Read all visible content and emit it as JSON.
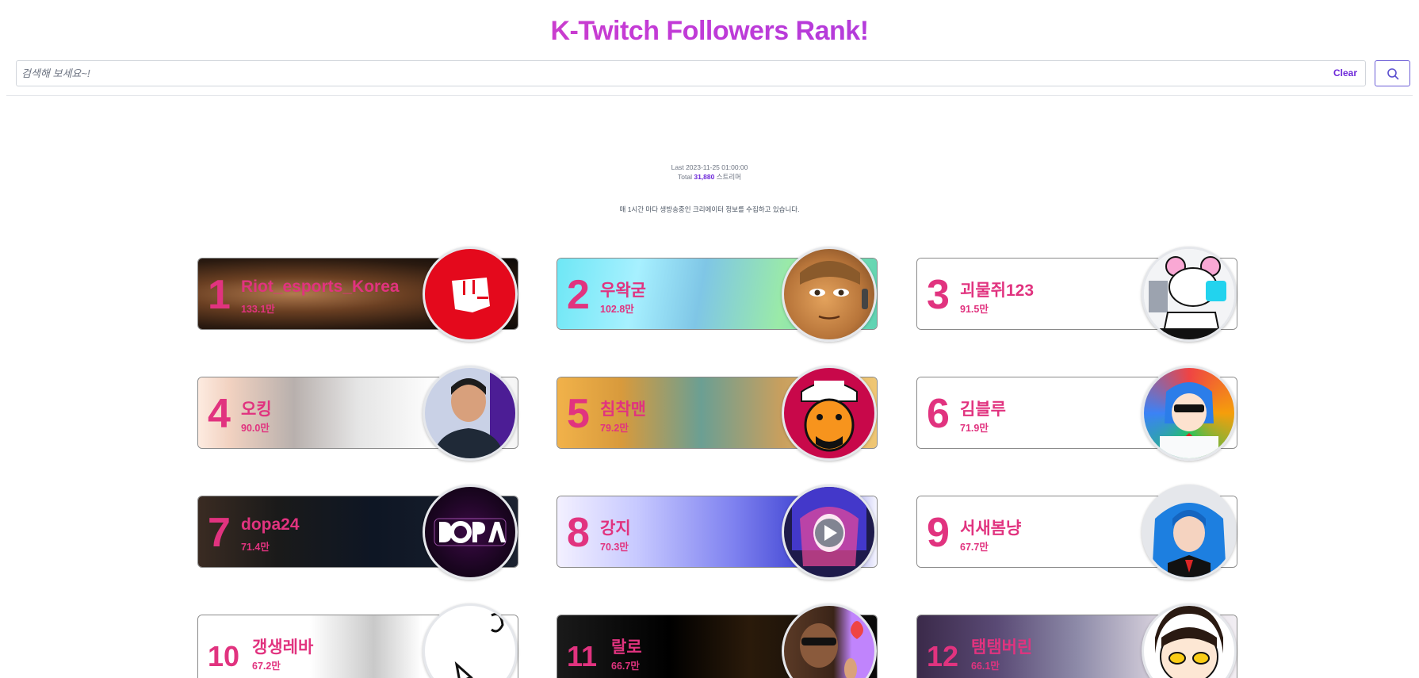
{
  "header": {
    "title": "K-Twitch Followers Rank!"
  },
  "search": {
    "placeholder": "검색해 보세요~!",
    "clear_label": "Clear",
    "icon": "search-icon"
  },
  "stats": {
    "last_label": "Last",
    "last_value": "2023-11-25 01:00:00",
    "total_label": "Total",
    "total_value": "31,880",
    "total_unit": "스트리머",
    "description": "매 1시간 마다 생방송중인 크리에이터 정보를 수집하고 있습니다."
  },
  "colors": {
    "accent": "#e1337f",
    "brand_purple": "#6d28d9"
  },
  "streamers": [
    {
      "rank": "1",
      "name": "Riot_esports_Korea",
      "followers": "133.1만"
    },
    {
      "rank": "2",
      "name": "우왁굳",
      "followers": "102.8만"
    },
    {
      "rank": "3",
      "name": "괴물쥐123",
      "followers": "91.5만"
    },
    {
      "rank": "4",
      "name": "오킹",
      "followers": "90.0만"
    },
    {
      "rank": "5",
      "name": "침착맨",
      "followers": "79.2만"
    },
    {
      "rank": "6",
      "name": "김블루",
      "followers": "71.9만"
    },
    {
      "rank": "7",
      "name": "dopa24",
      "followers": "71.4만"
    },
    {
      "rank": "8",
      "name": "강지",
      "followers": "70.3만"
    },
    {
      "rank": "9",
      "name": "서새봄냥",
      "followers": "67.7만"
    },
    {
      "rank": "10",
      "name": "갱생레바",
      "followers": "67.2만"
    },
    {
      "rank": "11",
      "name": "랄로",
      "followers": "66.7만"
    },
    {
      "rank": "12",
      "name": "탬탬버린",
      "followers": "66.1만"
    }
  ]
}
